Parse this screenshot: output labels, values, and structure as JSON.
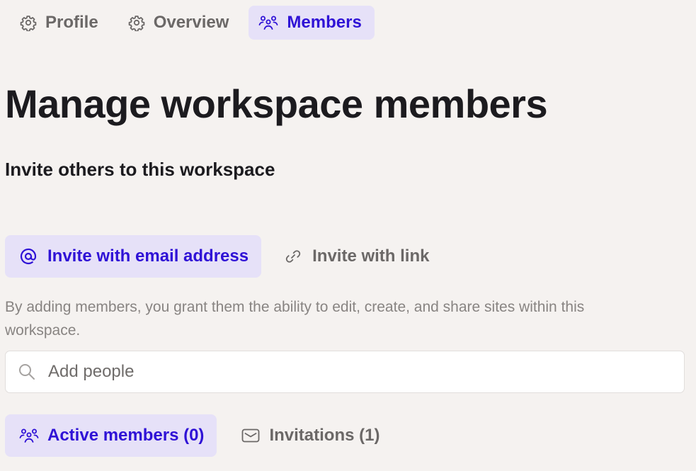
{
  "nav": {
    "tabs": [
      {
        "label": "Profile",
        "icon": "gear-icon",
        "active": false
      },
      {
        "label": "Overview",
        "icon": "gear-icon",
        "active": false
      },
      {
        "label": "Members",
        "icon": "members-icon",
        "active": true
      }
    ]
  },
  "page": {
    "title": "Manage workspace members",
    "subtitle": "Invite others to this workspace"
  },
  "invite": {
    "tabs": [
      {
        "label": "Invite with email address",
        "icon": "at-sign-icon",
        "active": true
      },
      {
        "label": "Invite with link",
        "icon": "link-icon",
        "active": false
      }
    ],
    "description": "By adding members, you grant them the ability to edit, create, and share sites within this workspace."
  },
  "search": {
    "placeholder": "Add people",
    "value": ""
  },
  "members": {
    "tabs": [
      {
        "label": "Active members (0)",
        "icon": "members-icon",
        "active": true
      },
      {
        "label": "Invitations (1)",
        "icon": "envelope-icon",
        "active": false
      }
    ]
  },
  "colors": {
    "background": "#f5f2f0",
    "accent": "#2f12d6",
    "active_tab_background": "#e6e1f8",
    "muted_text": "#6b6867"
  }
}
